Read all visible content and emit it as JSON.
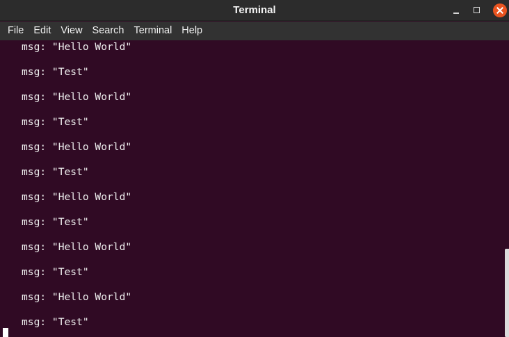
{
  "window": {
    "title": "Terminal"
  },
  "menu": [
    "File",
    "Edit",
    "View",
    "Search",
    "Terminal",
    "Help"
  ],
  "terminal": {
    "lines": [
      "msg: \"Hello World\"",
      "msg: \"Test\"",
      "msg: \"Hello World\"",
      "msg: \"Test\"",
      "msg: \"Hello World\"",
      "msg: \"Test\"",
      "msg: \"Hello World\"",
      "msg: \"Test\"",
      "msg: \"Hello World\"",
      "msg: \"Test\"",
      "msg: \"Hello World\"",
      "msg: \"Test\""
    ]
  },
  "colors": {
    "background": "#300a24",
    "text": "#ededed",
    "close_button": "#e95420",
    "titlebar": "#2c2c2c",
    "menubar": "#323232"
  },
  "icons": {
    "minimize": "minimize-icon",
    "maximize": "maximize-icon",
    "close": "close-icon"
  }
}
